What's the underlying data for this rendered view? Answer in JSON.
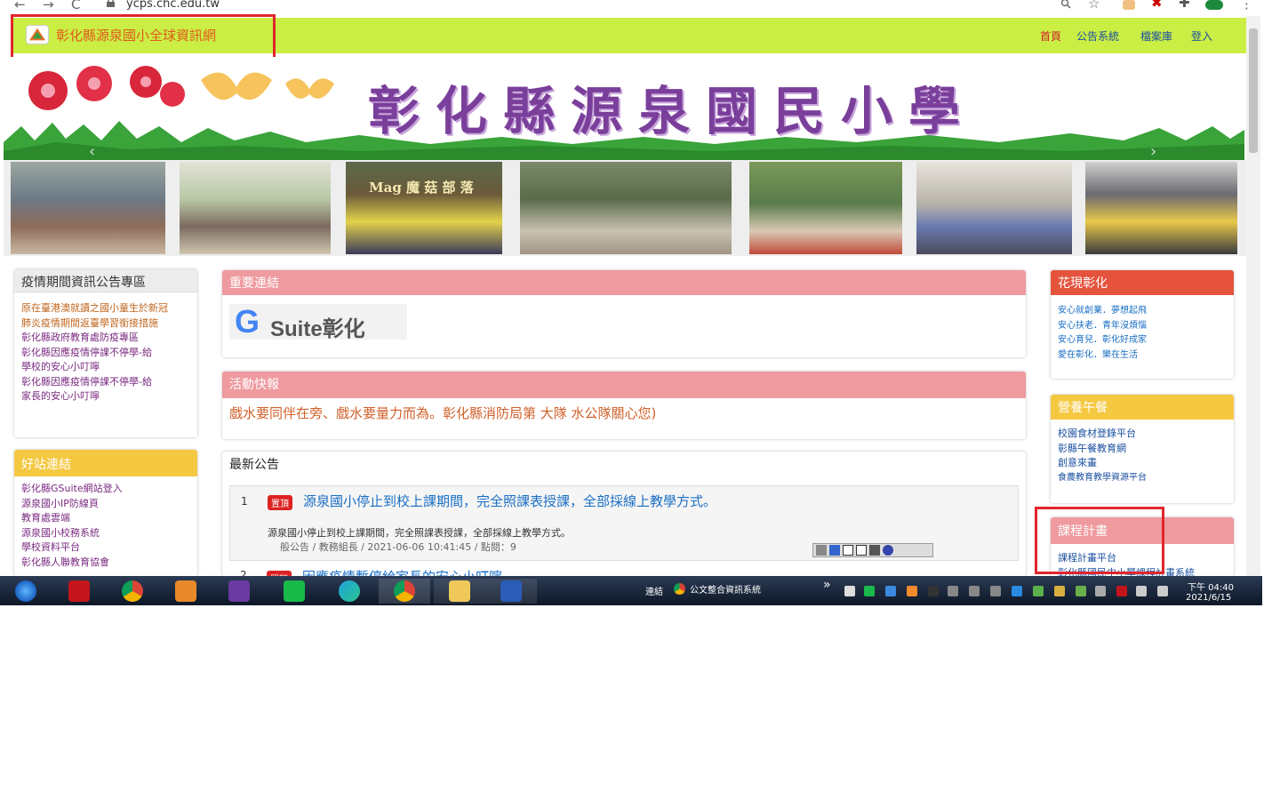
{
  "browser": {
    "url": "ycps.chc.edu.tw",
    "back_glyph": "←",
    "forward_glyph": "→",
    "reload_glyph": "C"
  },
  "header": {
    "site_title": "彰化縣源泉國小全球資訊網",
    "nav": [
      "首頁",
      "公告系統",
      "檔案庫",
      "登入"
    ]
  },
  "banner": {
    "title": "彰化縣源泉國民小學"
  },
  "photos": {
    "sign_text": "Mag 魔 菇 部 落"
  },
  "left_panel_1": {
    "title": "疫情期間資訊公告專區",
    "items": [
      "原在臺港澳就讀之國小童生於新冠",
      "肺炎疫情期間返臺學習銜接措施",
      "彰化縣政府教育處防疫專區",
      "彰化縣因應疫情停課不停學-給",
      "學校的安心小叮嚀",
      "彰化縣因應疫情停課不停學-給",
      "家長的安心小叮嚀"
    ]
  },
  "left_panel_2": {
    "title": "好站連結",
    "items": [
      "彰化縣GSuite網站登入",
      "源泉國小IP防線頁",
      "教育處雲端",
      "源泉國小校務系統",
      "學校資料平台",
      "彰化縣人聯教育協會"
    ]
  },
  "important_links": {
    "title": "重要連結",
    "gsuite_label": "Suite彰化",
    "gsuite_g": "G"
  },
  "activity": {
    "title": "活動快報",
    "text": "戲水要同伴在旁、戲水要量力而為。彰化縣消防局第  大隊  水公隊關心您)"
  },
  "news": {
    "title": "最新公告",
    "item1": {
      "index": "1",
      "badge": "置頂",
      "headline": "源泉國小停止到校上課期間，完全照課表授課，全部採線上教學方式。",
      "summary": "源泉國小停止到校上課期間，完全照課表授課，全部採線上教學方式。",
      "meta": "般公告 / 教務組長 / 2021-06-06 10:41:45 / 點閱：9"
    },
    "item2": {
      "index": "2",
      "badge": "置頂",
      "headline": "因應疫情暫停給家長的安心小叮嚀"
    }
  },
  "right_panel_1": {
    "title": "花現彰化",
    "items": [
      "安心就創業．夢想起飛",
      "安心扶老．青年沒煩惱",
      "安心育兒．彰化好成家",
      "愛在彰化．樂在生活"
    ]
  },
  "right_panel_2": {
    "title": "營養午餐",
    "items": [
      "校園食材登錄平台",
      "彰縣午餐教育網",
      "創意來畫",
      "食農教育教學資源平台"
    ]
  },
  "right_panel_3": {
    "title": "課程計畫",
    "items": [
      "課程計畫平台",
      "彰化縣國民中小學課程計畫系統"
    ]
  },
  "taskbar": {
    "label": "連結",
    "app_name": "公文整合資訊系統",
    "chevron": "»",
    "time": "下午 04:40",
    "date": "2021/6/15"
  },
  "colors": {
    "header_bg": "#cbee45",
    "title_orange": "#e05a1a",
    "pink_head": "#ee9a9f",
    "red_head": "#e5533d",
    "yellow_head": "#f5c842",
    "highlight": "#e0262b"
  }
}
